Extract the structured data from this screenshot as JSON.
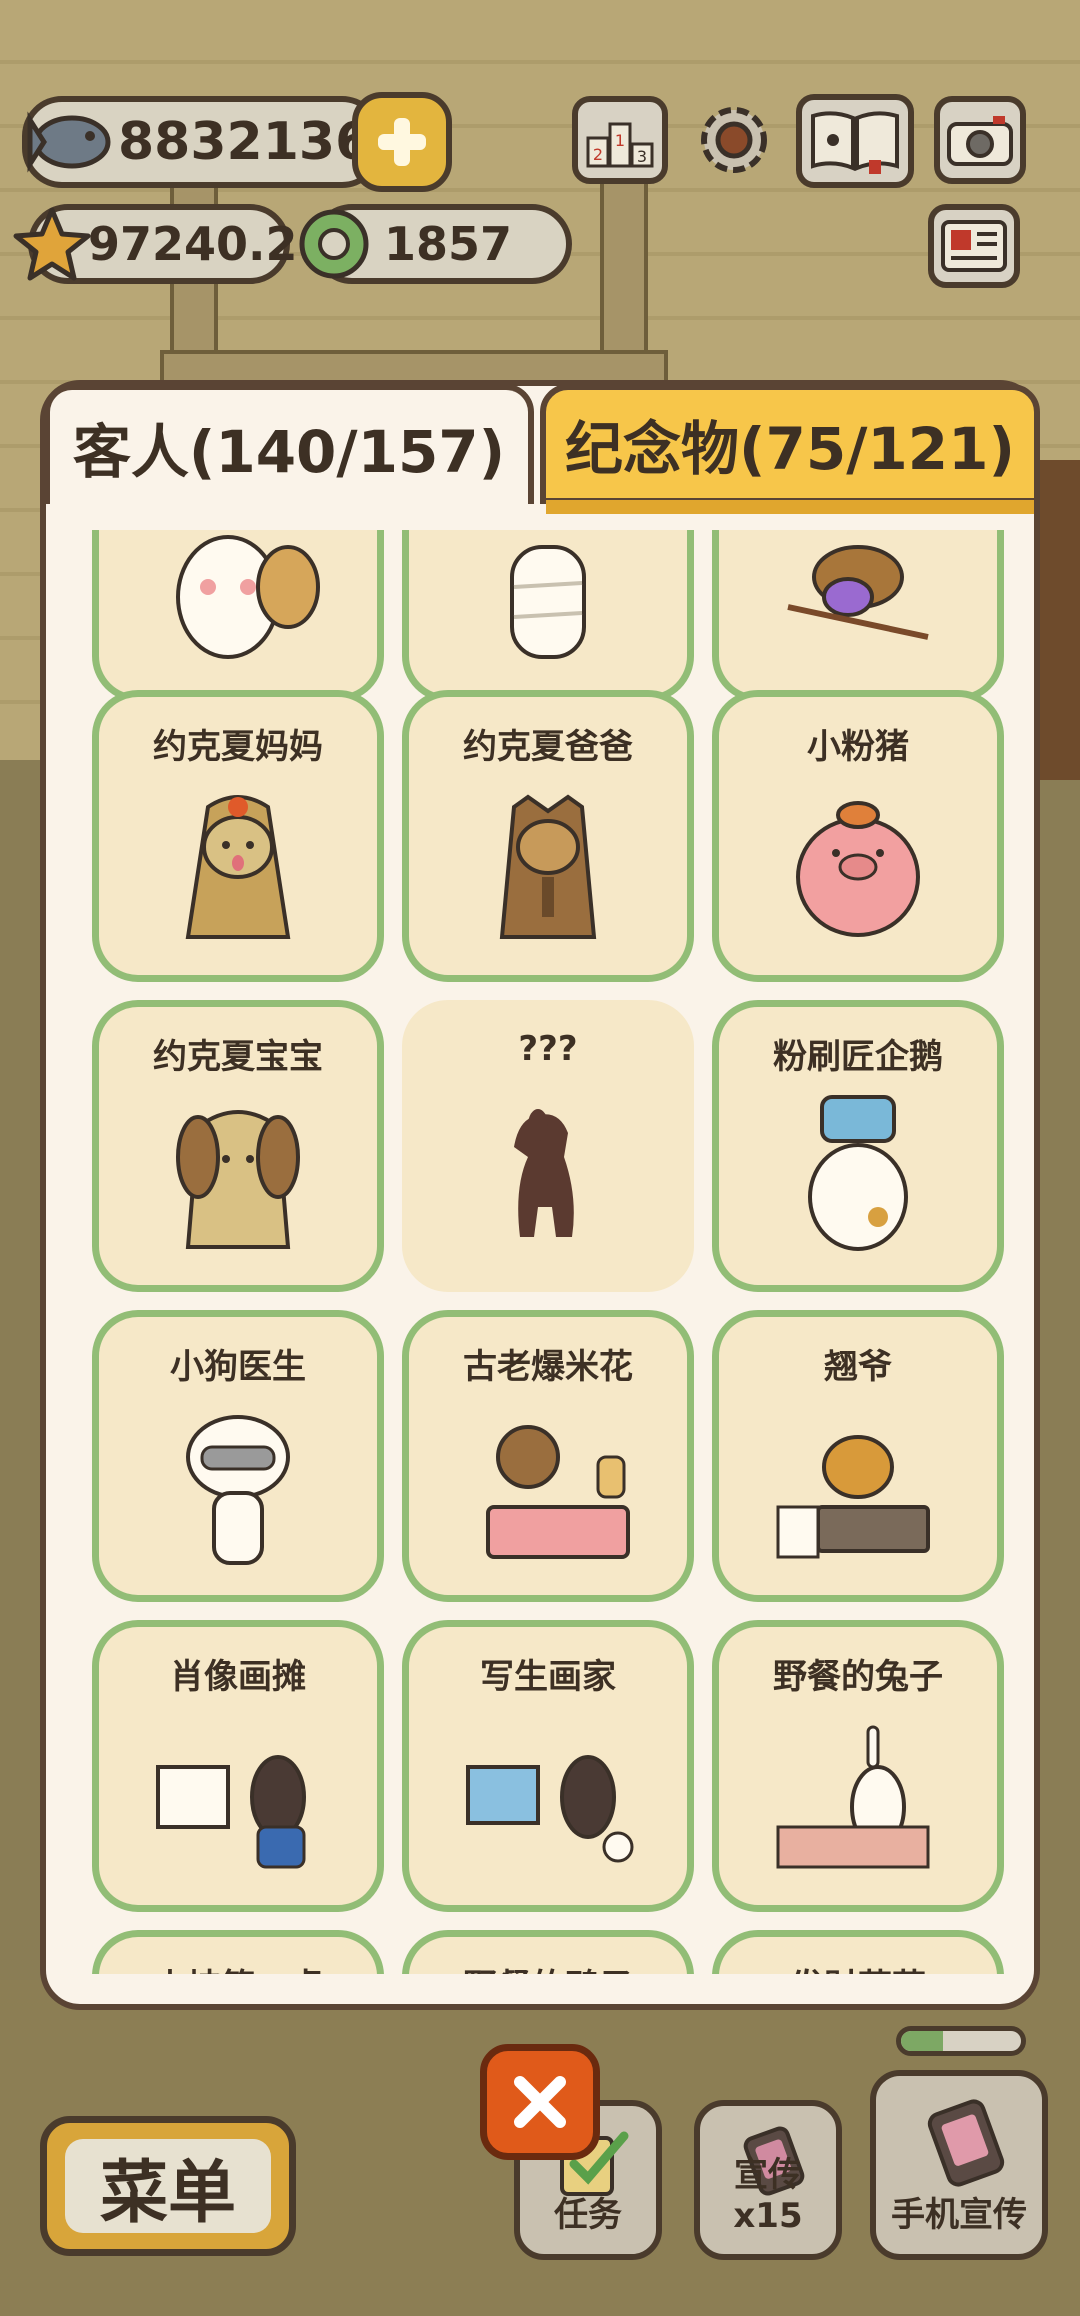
{
  "hud": {
    "fish_amount": "8832136",
    "star_amount": "97240.2",
    "ring_amount": "1857"
  },
  "tabs": {
    "guests_label": "客人(140/157)",
    "souvenirs_label": "纪念物(75/121)"
  },
  "guests": [
    {
      "name": ""
    },
    {
      "name": ""
    },
    {
      "name": ""
    },
    {
      "name": "约克夏妈妈"
    },
    {
      "name": "约克夏爸爸"
    },
    {
      "name": "小粉猪"
    },
    {
      "name": "约克夏宝宝"
    },
    {
      "name": "???"
    },
    {
      "name": "粉刷匠企鹅"
    },
    {
      "name": "小狗医生"
    },
    {
      "name": "古老爆米花"
    },
    {
      "name": "翘爷"
    },
    {
      "name": "肖像画摊"
    },
    {
      "name": "写生画家"
    },
    {
      "name": "野餐的兔子"
    },
    {
      "name": "山坡第一桌"
    },
    {
      "name": "野餐的鸭子"
    },
    {
      "name": "发财菇菇"
    }
  ],
  "bottom": {
    "menu_label": "菜单",
    "tasks_label": "任务",
    "promo_label": "宣传x15",
    "phone_promo_label": "手机宣传",
    "progress_fraction": 0.35
  },
  "colors": {
    "card_border": "#92bd76",
    "card_bg": "#f6e8c8",
    "tab_inactive": "#f7c64a",
    "close_button": "#e05a1a"
  }
}
